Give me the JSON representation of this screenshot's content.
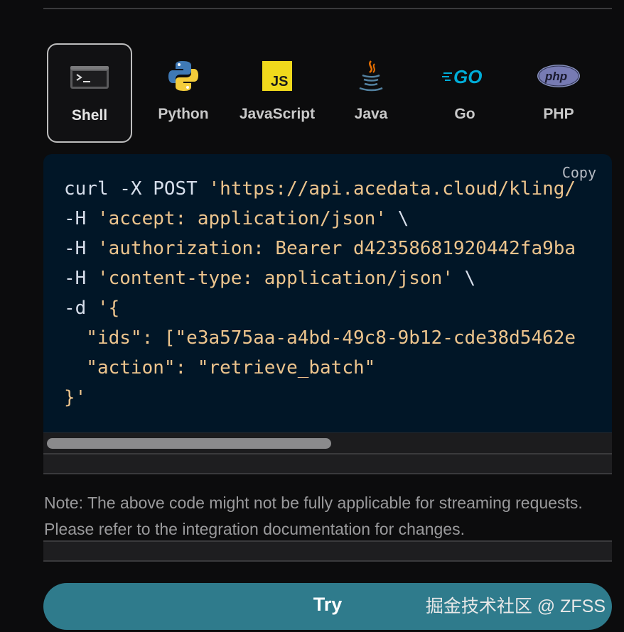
{
  "languages": [
    {
      "label": "Shell",
      "icon": "terminal-icon",
      "active": true
    },
    {
      "label": "Python",
      "icon": "python-logo-icon",
      "active": false
    },
    {
      "label": "JavaScript",
      "icon": "javascript-logo-icon",
      "active": false
    },
    {
      "label": "Java",
      "icon": "java-logo-icon",
      "active": false
    },
    {
      "label": "Go",
      "icon": "go-logo-icon",
      "active": false
    },
    {
      "label": "PHP",
      "icon": "php-logo-icon",
      "active": false
    }
  ],
  "code": {
    "copy_label": "Copy",
    "lines": [
      [
        "curl -X POST ",
        "'https://api.acedata.cloud/kling/"
      ],
      [
        "-H ",
        "'accept: application/json'",
        " \\"
      ],
      [
        "-H ",
        "'authorization: Bearer d42358681920442fa9ba"
      ],
      [
        "-H ",
        "'content-type: application/json'",
        " \\"
      ],
      [
        "-d ",
        "'{"
      ],
      [
        "  \"ids\": [\"e3a575aa-a4bd-49c8-9b12-cde38d5462e"
      ],
      [
        "  \"action\": \"retrieve_batch\""
      ],
      [
        "}'"
      ]
    ]
  },
  "note": "Note: The above code might not be fully applicable for streaming requests. Please refer to the integration documentation for changes.",
  "try_label": "Try",
  "watermark": "掘金技术社区 @ ZFSS",
  "colors": {
    "code_bg": "#011627",
    "code_text": "#d6deeb",
    "code_string": "#ecc48d",
    "try_button": "#2f7b8c"
  }
}
